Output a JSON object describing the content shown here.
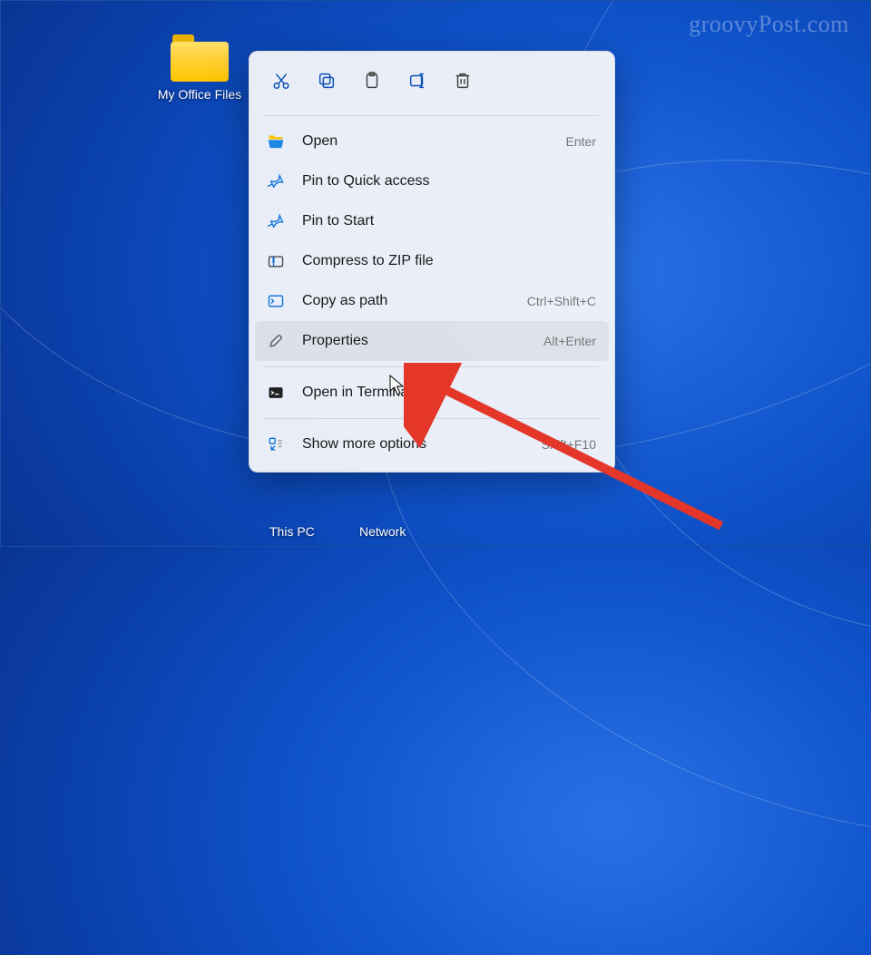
{
  "watermark": "groovyPost.com",
  "desktop": {
    "folder_label": "My Office Files",
    "this_pc": "This PC",
    "network": "Network"
  },
  "context_menu": {
    "action_icons": [
      "cut-icon",
      "copy-icon",
      "paste-icon",
      "rename-icon",
      "delete-icon"
    ],
    "items": [
      {
        "icon": "open-folder-icon",
        "label": "Open",
        "shortcut": "Enter"
      },
      {
        "icon": "pin-icon",
        "label": "Pin to Quick access",
        "shortcut": ""
      },
      {
        "icon": "pin-icon",
        "label": "Pin to Start",
        "shortcut": ""
      },
      {
        "icon": "zip-icon",
        "label": "Compress to ZIP file",
        "shortcut": ""
      },
      {
        "icon": "copy-path-icon",
        "label": "Copy as path",
        "shortcut": "Ctrl+Shift+C"
      },
      {
        "icon": "properties-icon",
        "label": "Properties",
        "shortcut": "Alt+Enter"
      },
      {
        "icon": "terminal-icon",
        "label": "Open in Terminal",
        "shortcut": ""
      },
      {
        "icon": "more-options-icon",
        "label": "Show more options",
        "shortcut": "Shift+F10"
      }
    ],
    "highlighted_index": 5
  }
}
